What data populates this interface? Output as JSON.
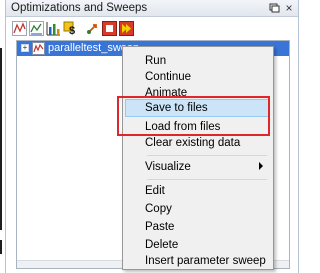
{
  "panel": {
    "title": "Optimizations and Sweeps",
    "float_icon": "pin-icon",
    "close_label": "×"
  },
  "toolbar": {
    "icons": [
      "parameter-sweep-icon",
      "optimization-icon",
      "bar-chart-icon",
      "dollar-sign-icon",
      "run-icon",
      "stop-icon",
      "forward-icon"
    ]
  },
  "tree": {
    "items": [
      {
        "label": "paralleltest_sweep",
        "expander": "+",
        "selected": true
      }
    ]
  },
  "context_menu": {
    "items": [
      {
        "label": "Run"
      },
      {
        "label": "Continue"
      },
      {
        "label": "Animate"
      },
      {
        "label": "Save to files"
      },
      {
        "label": "Load from files"
      },
      {
        "label": "Clear existing data"
      },
      {
        "label": "Visualize"
      },
      {
        "label": "Edit"
      },
      {
        "label": "Copy"
      },
      {
        "label": "Paste"
      },
      {
        "label": "Delete"
      },
      {
        "label": "Insert parameter sweep"
      }
    ]
  },
  "colors": {
    "selection": "#3875d7",
    "highlight": "#cce4f7",
    "annotation": "#e0262b"
  }
}
